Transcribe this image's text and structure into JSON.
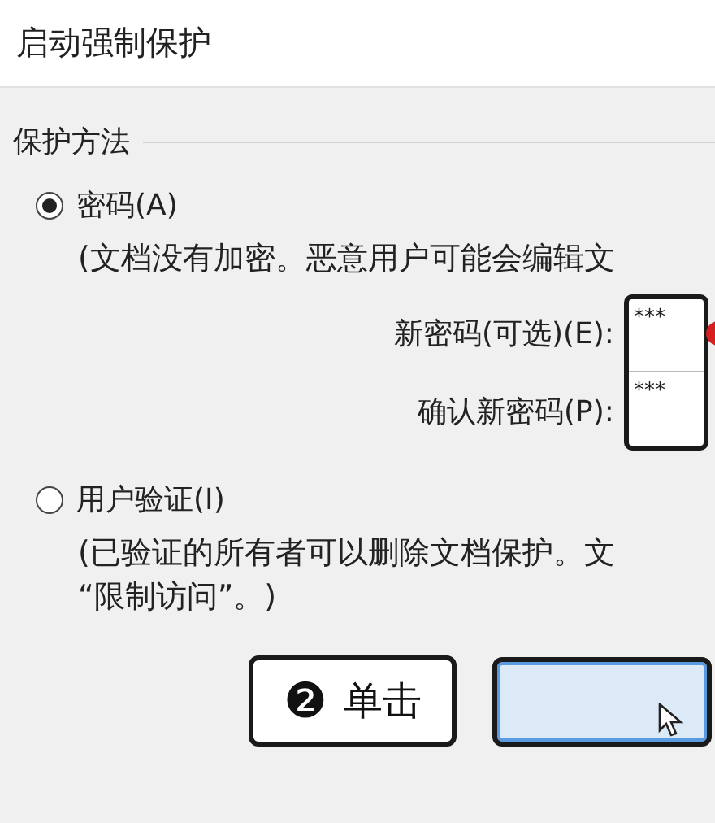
{
  "title": "启动强制保护",
  "group": {
    "label": "保护方法",
    "options": [
      {
        "label": "密码(A)",
        "selected": true,
        "description": [
          "(文档没有加密。恶意用户可能会编辑文"
        ],
        "fields": [
          {
            "label": "新密码(可选)(E):",
            "value": "***"
          },
          {
            "label": "确认新密码(P):",
            "value": "***"
          }
        ]
      },
      {
        "label": "用户验证(I)",
        "selected": false,
        "description": [
          "(已验证的所有者可以删除文档保护。文",
          "“限制访问”。)"
        ]
      }
    ]
  },
  "callouts": [
    {
      "number": "❷",
      "text": "单击"
    }
  ]
}
